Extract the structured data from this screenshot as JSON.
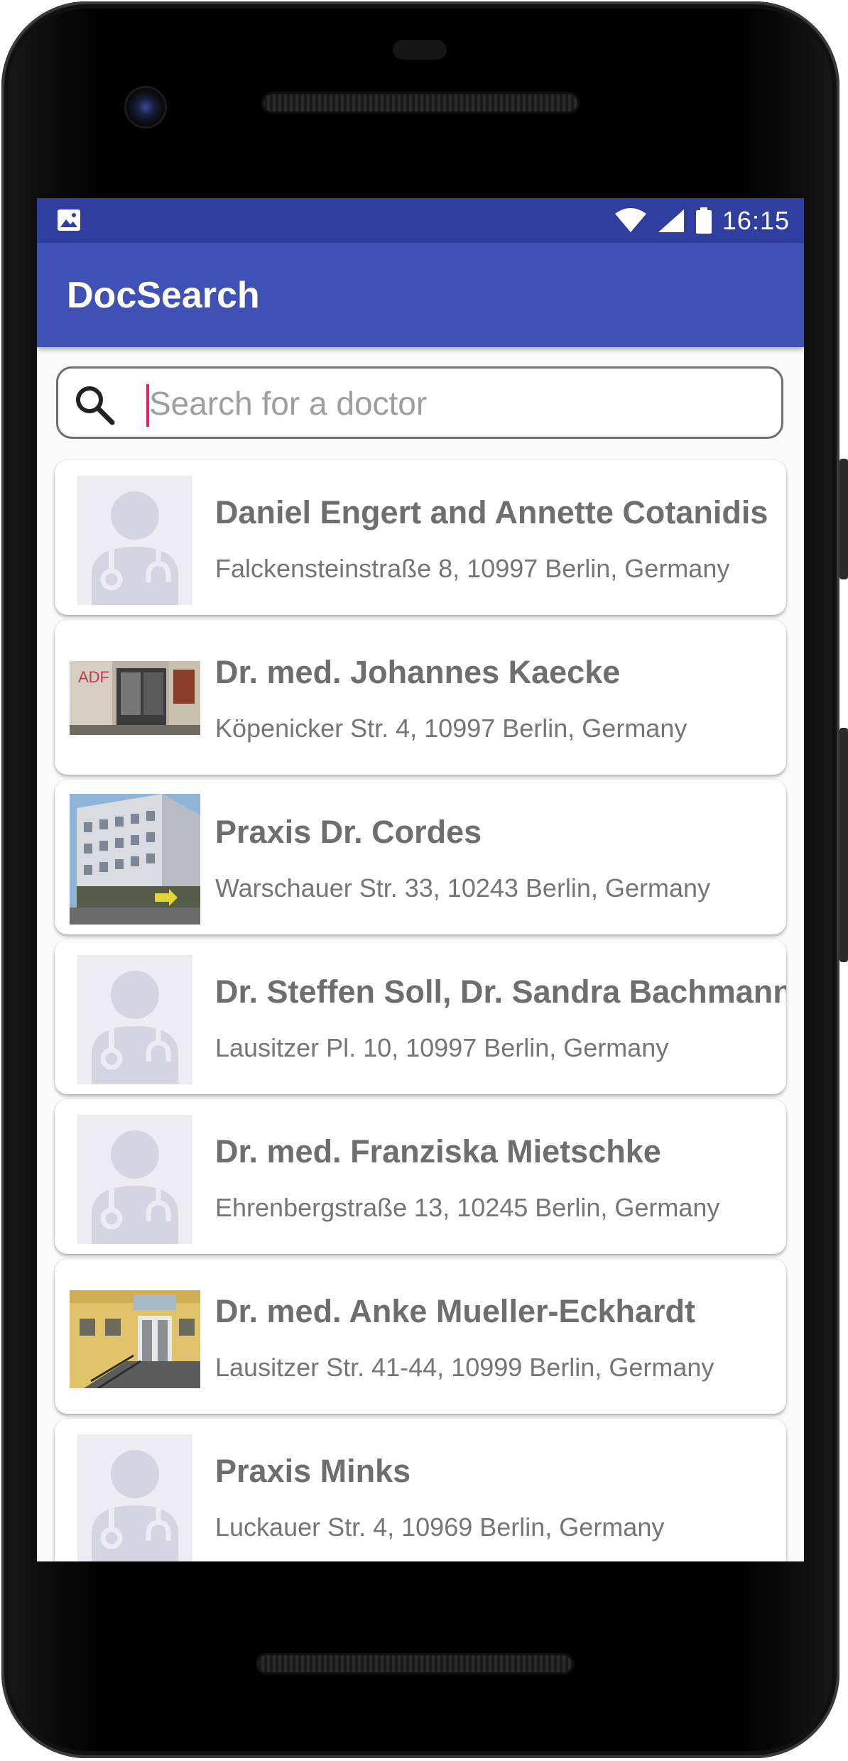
{
  "status_bar": {
    "time": "16:15",
    "left_icon": "image-icon",
    "right_icons": [
      "wifi-icon",
      "cell-signal-icon",
      "battery-icon"
    ]
  },
  "app_bar": {
    "title": "DocSearch"
  },
  "search": {
    "placeholder": "Search for a doctor",
    "value": "",
    "icon": "search-icon"
  },
  "doctors": [
    {
      "name": "Daniel Engert and Annette Cotanidis",
      "address": "Falckensteinstraße 8, 10997 Berlin, Germany",
      "image": "doctor-placeholder-icon"
    },
    {
      "name": "Dr. med. Johannes Kaecke",
      "address": "Köpenicker Str. 4, 10997 Berlin, Germany",
      "image": "storefront-photo"
    },
    {
      "name": "Praxis Dr. Cordes",
      "address": "Warschauer Str. 33, 10243 Berlin, Germany",
      "image": "building-photo"
    },
    {
      "name": "Dr. Steffen Soll, Dr. Sandra Bachmann",
      "address": "Lausitzer Pl. 10, 10997 Berlin, Germany",
      "image": "doctor-placeholder-icon"
    },
    {
      "name": "Dr. med. Franziska Mietschke",
      "address": "Ehrenbergstraße 13, 10245 Berlin, Germany",
      "image": "doctor-placeholder-icon"
    },
    {
      "name": "Dr. med. Anke Mueller-Eckhardt",
      "address": "Lausitzer Str. 41-44, 10999 Berlin, Germany",
      "image": "entrance-photo"
    },
    {
      "name": "Praxis Minks",
      "address": "Luckauer Str. 4, 10969 Berlin, Germany",
      "image": "doctor-placeholder-icon"
    }
  ],
  "colors": {
    "status_bar": "#303f9f",
    "app_bar": "#3f51b5",
    "accent_caret": "#e91e63",
    "placeholder_avatar": "#d5d5e2"
  }
}
